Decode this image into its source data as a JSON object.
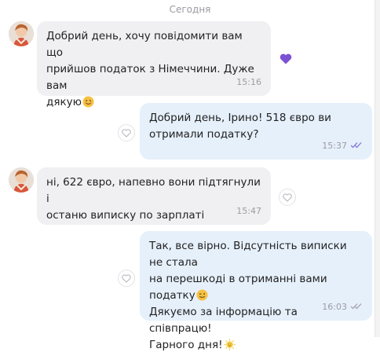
{
  "date_separator": "Сегодня",
  "colors": {
    "incoming_bubble": "#f0f0f2",
    "outgoing_bubble": "#e6f0fb",
    "reaction_heart": "#7b52d3",
    "read_ticks": "#8b7fd8"
  },
  "messages": [
    {
      "direction": "incoming",
      "lines": [
        "Добрий день, хочу повідомити вам що",
        "прийшов податок з Німеччини. Дуже вам",
        "дякую"
      ],
      "emoji": "smiling-face",
      "time": "15:16",
      "reaction": "purple-heart"
    },
    {
      "direction": "outgoing",
      "lines": [
        "Добрий день, Ірино! 518 євро ви",
        "отримали податку?"
      ],
      "time": "15:37",
      "status": "read-double-check"
    },
    {
      "direction": "incoming",
      "lines": [
        "ні, 622 євро, напевно вони підтягнули і",
        "останю виписку по зарплаті"
      ],
      "time": "15:47"
    },
    {
      "direction": "outgoing",
      "lines": [
        "Так, все вірно. Відсутність виписки не стала",
        "на перешкоді в отриманні вами податку",
        "Дякуємо за інформацію та співпрацю!",
        "Гарного дня!"
      ],
      "emoji_line2": "winking-face",
      "emoji_line4": "sun-face",
      "time": "16:03",
      "status": "delivered-double-check"
    }
  ]
}
